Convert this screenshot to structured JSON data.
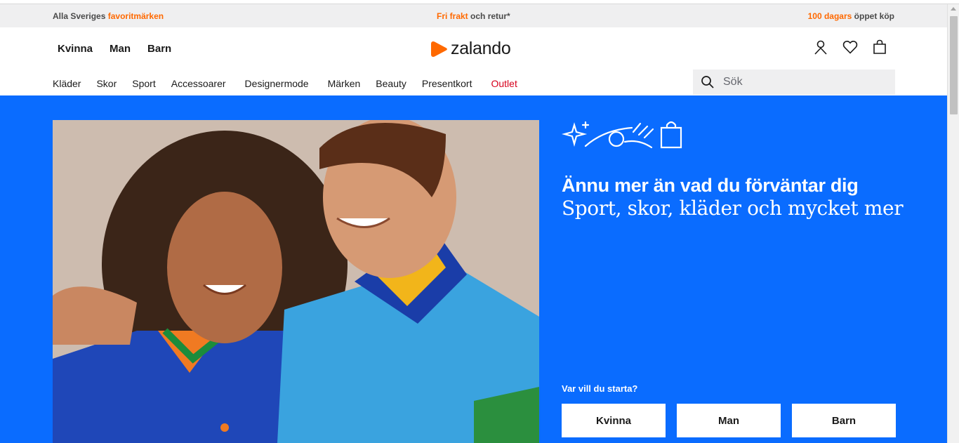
{
  "promo": {
    "left_prefix": "Alla Sveriges ",
    "left_highlight": "favoritmärken",
    "center_highlight": "Fri frakt",
    "center_suffix": " och retur*",
    "right_highlight": "100 dagars",
    "right_suffix": " öppet köp"
  },
  "header": {
    "gender_nav": [
      "Kvinna",
      "Man",
      "Barn"
    ],
    "logo_text": "zalando",
    "icons": [
      "user-icon",
      "heart-icon",
      "shopping-bag-icon"
    ],
    "categories": [
      "Kläder",
      "Skor",
      "Sport",
      "Accessoarer",
      "Designermode",
      "Märken",
      "Beauty",
      "Presentkort",
      "Outlet"
    ],
    "search_placeholder": "Sök"
  },
  "hero": {
    "headline": "Ännu mer än vad du förväntar dig",
    "subline": "Sport, skor, kläder och mycket mer",
    "start_label": "Var vill du starta?",
    "start_buttons": [
      "Kvinna",
      "Man",
      "Barn"
    ]
  },
  "colors": {
    "brand_orange": "#ff6900",
    "hero_blue": "#0a6cff",
    "outlet_red": "#d6001c",
    "promo_bg": "#efeff0"
  }
}
